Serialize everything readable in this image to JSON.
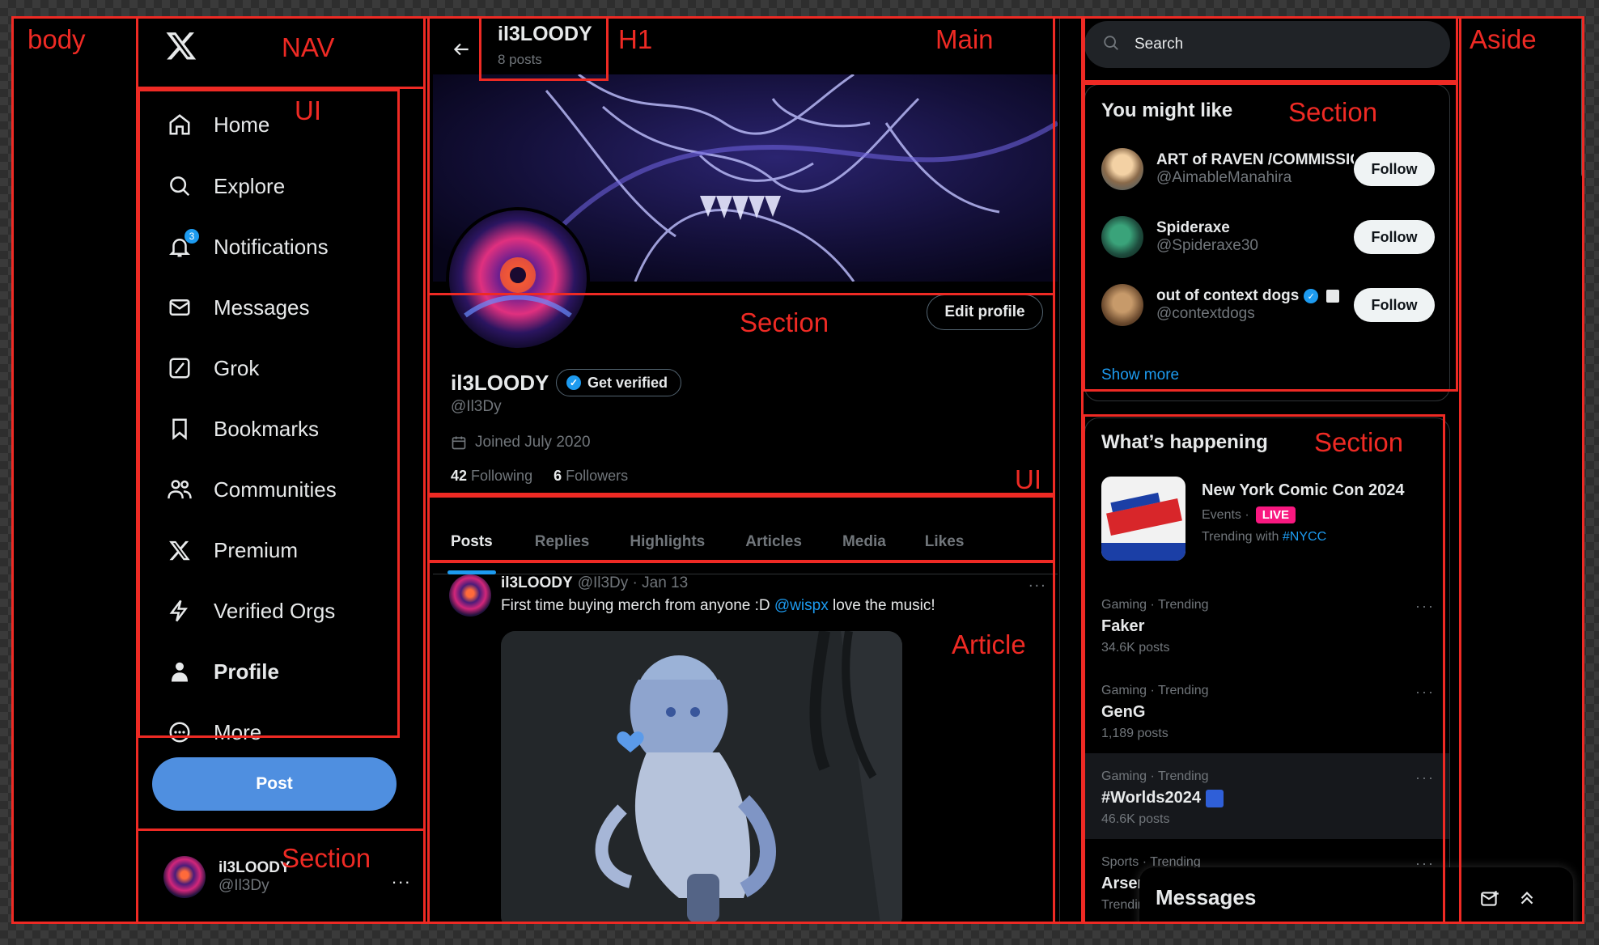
{
  "overlay_labels": {
    "body": "body",
    "nav": "NAV",
    "ui_nav": "UI",
    "h1": "H1",
    "main": "Main",
    "section_profile": "Section",
    "ui_tabs": "UI",
    "article": "Article",
    "aside": "Aside",
    "section_wtf": "Section",
    "section_trends": "Section",
    "section_account": "Section"
  },
  "nav": {
    "items": [
      {
        "label": "Home",
        "icon": "home-icon"
      },
      {
        "label": "Explore",
        "icon": "search-icon"
      },
      {
        "label": "Notifications",
        "icon": "bell-icon",
        "badge": "3"
      },
      {
        "label": "Messages",
        "icon": "envelope-icon"
      },
      {
        "label": "Grok",
        "icon": "grok-icon"
      },
      {
        "label": "Bookmarks",
        "icon": "bookmark-icon"
      },
      {
        "label": "Communities",
        "icon": "communities-icon"
      },
      {
        "label": "Premium",
        "icon": "x-logo-icon"
      },
      {
        "label": "Verified Orgs",
        "icon": "lightning-icon"
      },
      {
        "label": "Profile",
        "icon": "person-icon"
      },
      {
        "label": "More",
        "icon": "more-circle-icon"
      }
    ],
    "post_label": "Post",
    "account": {
      "name": "il3LOODY",
      "handle": "@Il3Dy",
      "more": "..."
    }
  },
  "header": {
    "name": "il3LOODY",
    "posts": "8 posts"
  },
  "profile": {
    "edit_label": "Edit profile",
    "name": "il3LOODY",
    "get_verified": "Get verified",
    "handle": "@Il3Dy",
    "joined": "Joined July 2020",
    "following_count": "42",
    "following_label": "Following",
    "followers_count": "6",
    "followers_label": "Followers"
  },
  "tabs": [
    "Posts",
    "Replies",
    "Highlights",
    "Articles",
    "Media",
    "Likes"
  ],
  "tweet": {
    "name": "il3LOODY",
    "meta": "@Il3Dy · Jan 13",
    "more": "...",
    "text_before": "First time buying merch from anyone :D ",
    "mention": "@wispx",
    "text_after": "  love the music!"
  },
  "search": {
    "placeholder": "Search"
  },
  "who_to_follow": {
    "title": "You might like",
    "accounts": [
      {
        "name": "ART of RAVEN /COMMISSIONS OPEN",
        "handle": "@AimableManahira",
        "button": "Follow"
      },
      {
        "name": "Spideraxe",
        "handle": "@Spideraxe30",
        "button": "Follow"
      },
      {
        "name": "out of context dogs",
        "handle": "@contextdogs",
        "button": "Follow"
      }
    ],
    "show_more": "Show more"
  },
  "trends": {
    "title": "What’s happening",
    "featured": {
      "name": "New York Comic Con 2024",
      "category": "Events ·",
      "live": "LIVE",
      "trending_with": "Trending with",
      "hashtag": "#NYCC"
    },
    "items": [
      {
        "meta": "Gaming · Trending",
        "name": "Faker",
        "count": "34.6K posts"
      },
      {
        "meta": "Gaming · Trending",
        "name": "GenG",
        "count": "1,189 posts"
      },
      {
        "meta": "Gaming · Trending",
        "name": "#Worlds2024",
        "count": "46.6K posts"
      },
      {
        "meta": "Sports · Trending",
        "name": "Arsenal",
        "count": "Trending"
      }
    ]
  },
  "messages_drawer": {
    "title": "Messages"
  },
  "colors": {
    "accent": "#1d9bf0",
    "post_button": "#4f8fe0",
    "overlay": "#ee2a24",
    "live": "#f91880"
  }
}
